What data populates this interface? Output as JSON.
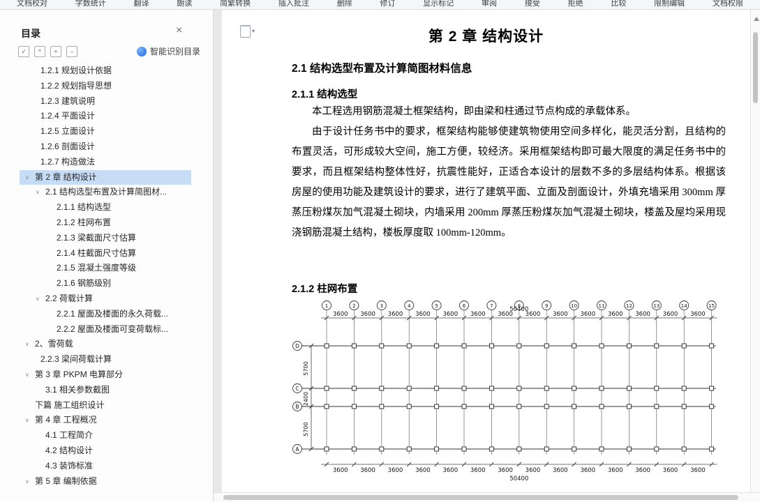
{
  "toolbar": {
    "items": [
      "文档校对",
      "字数统计",
      "翻译",
      "朗读",
      "简繁转换",
      "插入批注",
      "删除",
      "修订",
      "显示标记",
      "审阅",
      "接受",
      "拒绝",
      "比较",
      "限制编辑",
      "文档权限"
    ]
  },
  "sidebar": {
    "title": "目录",
    "close_label": "×",
    "smart_button": "智能识别目录",
    "tools": [
      {
        "name": "toc-check-icon",
        "glyph": "✓"
      },
      {
        "name": "toc-collapse-icon",
        "glyph": "^"
      },
      {
        "name": "toc-expand-all-icon",
        "glyph": "+"
      },
      {
        "name": "toc-collapse-all-icon",
        "glyph": "−"
      }
    ],
    "tree": [
      {
        "label": "1.2.1 规划设计依据",
        "level": "l1"
      },
      {
        "label": "1.2.2 规划指导思想",
        "level": "l1"
      },
      {
        "label": "1.2.3 建筑说明",
        "level": "l1"
      },
      {
        "label": "1.2.4 平面设计",
        "level": "l1"
      },
      {
        "label": "1.2.5 立面设计",
        "level": "l1"
      },
      {
        "label": "1.2.6 剖面设计",
        "level": "l1"
      },
      {
        "label": "1.2.7 构造做法",
        "level": "l1"
      },
      {
        "label": "第 2 章 结构设计",
        "level": "l0",
        "caret": true,
        "selected": true
      },
      {
        "label": "2.1 结构选型布置及计算简图材...",
        "level": "l2",
        "caret": true
      },
      {
        "label": "2.1.1 结构选型",
        "level": "l3"
      },
      {
        "label": "2.1.2 柱网布置",
        "level": "l3"
      },
      {
        "label": "2.1.3 梁截面尺寸估算",
        "level": "l3"
      },
      {
        "label": "2.1.4 柱截面尺寸估算",
        "level": "l3"
      },
      {
        "label": "2.1.5 混凝土强度等级",
        "level": "l3"
      },
      {
        "label": "2.1.6 钢筋级别",
        "level": "l3"
      },
      {
        "label": "2.2 荷载计算",
        "level": "l2",
        "caret": true
      },
      {
        "label": "2.2.1 屋面及楼面的永久荷载...",
        "level": "l3"
      },
      {
        "label": "2.2.2 屋面及楼面可变荷载标...",
        "level": "l3"
      },
      {
        "label": "2、雪荷载",
        "level": "l0",
        "caret": true
      },
      {
        "label": "2.2.3 梁间荷载计算",
        "level": "l1"
      },
      {
        "label": "第 3 章  PKPM 电算部分",
        "level": "l0",
        "caret": true
      },
      {
        "label": "3.1 相关参数截图",
        "level": "l2"
      },
      {
        "label": "下篇 施工组织设计",
        "level": "l0"
      },
      {
        "label": "第 4 章  工程概况",
        "level": "l0",
        "caret": true
      },
      {
        "label": "4.1 工程简介",
        "level": "l2"
      },
      {
        "label": "4.2 结构设计",
        "level": "l2"
      },
      {
        "label": "4.3 装饰标准",
        "level": "l2"
      },
      {
        "label": "第 5 章 编制依据",
        "level": "l0",
        "caret": true
      }
    ]
  },
  "document": {
    "title": "第 2 章 结构设计",
    "heading_2_1": "2.1 结构选型布置及计算简图材料信息",
    "heading_2_1_1": "2.1.1 结构选型",
    "para_1": "本工程选用钢筋混凝土框架结构，即由梁和柱通过节点构成的承载体系。",
    "para_2": "由于设计任务书中的要求，框架结构能够使建筑物使用空间多样化，能灵活分割，且结构的布置灵活，可形成较大空间，施工方便，较经济。采用框架结构即可最大限度的满足任务书中的要求，而且框架结构整体性好，抗震性能好，正适合本设计的层数不多的多层结构体系。根据该房屋的使用功能及建筑设计的要求，进行了建筑平面、立面及剖面设计，外填充墙采用 300mm 厚蒸压粉煤灰加气混凝土砌块，内墙采用 200mm 厚蒸压粉煤灰加气混凝土砌块，楼盖及屋均采用现浇钢筋混凝土结构，楼板厚度取 100mm-120mm。",
    "heading_2_1_2": "2.1.2 柱网布置"
  },
  "diagram": {
    "type": "column-grid-plan",
    "columns": [
      "1",
      "2",
      "3",
      "4",
      "5",
      "6",
      "7",
      "8",
      "9",
      "10",
      "11",
      "12",
      "13",
      "14",
      "15"
    ],
    "rows": [
      "D",
      "C",
      "B",
      "A"
    ],
    "bay_label": "3600",
    "bay_count": 14,
    "total_top": "50400",
    "total_bottom": "50400",
    "row_spans": [
      "5700",
      "2400",
      "5700"
    ]
  },
  "colors": {
    "toc_selection": "#c7dcf5",
    "smart_icon_blue": "#2f7df6"
  }
}
